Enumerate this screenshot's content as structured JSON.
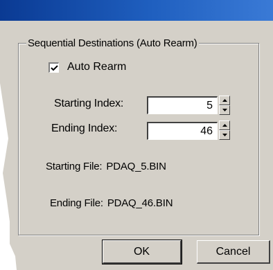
{
  "group": {
    "title": "Sequential Destinations (Auto Rearm)"
  },
  "auto_rearm": {
    "label": "Auto Rearm",
    "checked": true
  },
  "starting_index": {
    "label": "Starting Index:",
    "value": "5"
  },
  "ending_index": {
    "label": "Ending Index:",
    "value": "46"
  },
  "starting_file": {
    "label": "Starting File:",
    "value": "PDAQ_5.BIN"
  },
  "ending_file": {
    "label": "Ending File:",
    "value": "PDAQ_46.BIN"
  },
  "buttons": {
    "ok": "OK",
    "cancel": "Cancel"
  },
  "colors": {
    "title_bar": "#1f5fbf",
    "dialog_bg": "#d4d0c8"
  }
}
